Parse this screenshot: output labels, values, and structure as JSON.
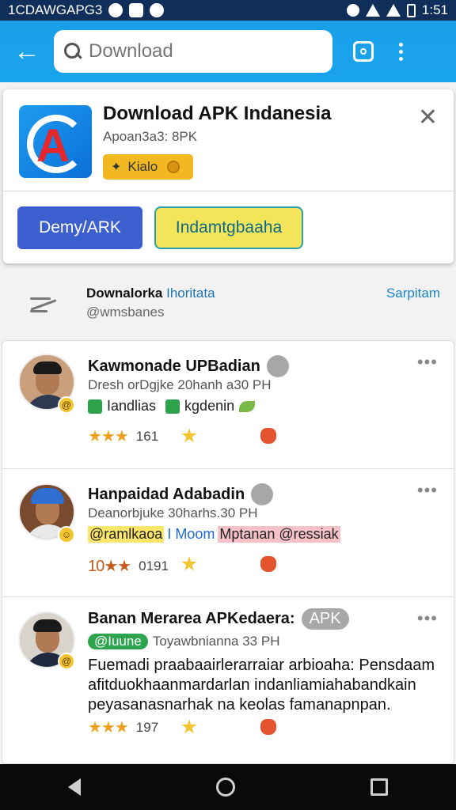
{
  "status_bar": {
    "left_text": "1CDAWGAPG3",
    "time": "1:51"
  },
  "app_bar": {
    "search_placeholder": "Download"
  },
  "banner": {
    "title": "Download APK Indanesia",
    "subtitle": "Apoan3a3: 8PK",
    "chip_label": "Kialo",
    "button_primary": "Demy/ARK",
    "button_secondary": "Indamtgbaaha",
    "brand_color": "#3b5fcf"
  },
  "section": {
    "heading_bold": "Downalorka",
    "heading_rest": "Ihoritata",
    "handle": "@wmsbanes",
    "link": "Sarpitam"
  },
  "posts": [
    {
      "name": "Kawmonade UPBadian",
      "meta": "Dresh orDgjke 20hanh a30 PH",
      "tag1": "Iandlias",
      "tag2": "kgdenin",
      "rating_stars": "★★★",
      "count": "161"
    },
    {
      "name": "Hanpaidad Adabadin",
      "meta": "Deanorbjuke 30harhs.30 PH",
      "hl1": "@ramlkaoa",
      "hl2": "I Moom",
      "hl3": "Mptanan @ressiak",
      "rating_stars": "10★★",
      "count": "0191"
    },
    {
      "name": "Banan Merarea APKedaera:",
      "pill": "APK",
      "green_tag": "@Iuune",
      "meta": "Toyawbnianna 33 PH",
      "body": "Fuemadi praabaairlerarraiar arbioaha: Pensdaam afitduokhaanmardarlan indanliamiahabandkain peyasanasnarhak na keolas famanapnpan.",
      "rating_stars": "★★★",
      "count": "197"
    }
  ]
}
